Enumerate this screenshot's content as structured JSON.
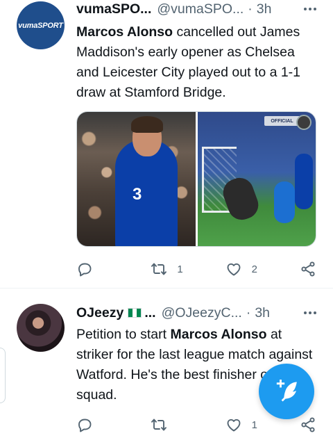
{
  "tweets": [
    {
      "name": "vumaSPO...",
      "handle": "@vumaSPO...",
      "time": "3h",
      "avatar_text": "vumaSPORT",
      "text_bold": "Marcos Alonso",
      "text_rest": " cancelled out James Maddison's early opener as Chelsea and Leicester City played out to a 1-1 draw at Stamford Bridge.",
      "media_board_text": "OFFICIAL",
      "media_shirt_number": "3",
      "replies": "",
      "retweets": "1",
      "likes": "2"
    },
    {
      "name": "OJeezy",
      "name_suffix": "...",
      "handle": "@OJeezyC...",
      "time": "3h",
      "text_pre": "Petition to start ",
      "text_bold": "Marcos Alonso",
      "text_rest": " at striker for the last league match against Watford. He's the best finisher on the squad.",
      "replies": "",
      "retweets": "",
      "likes": "1"
    }
  ],
  "separator_dot": "·",
  "icons": {
    "reply": "reply-icon",
    "retweet": "retweet-icon",
    "like": "heart-icon",
    "share": "share-icon",
    "more": "more-icon",
    "compose": "compose-tweet-icon"
  },
  "colors": {
    "accent": "#1d9bf0",
    "text": "#0f1419",
    "muted": "#536471"
  }
}
